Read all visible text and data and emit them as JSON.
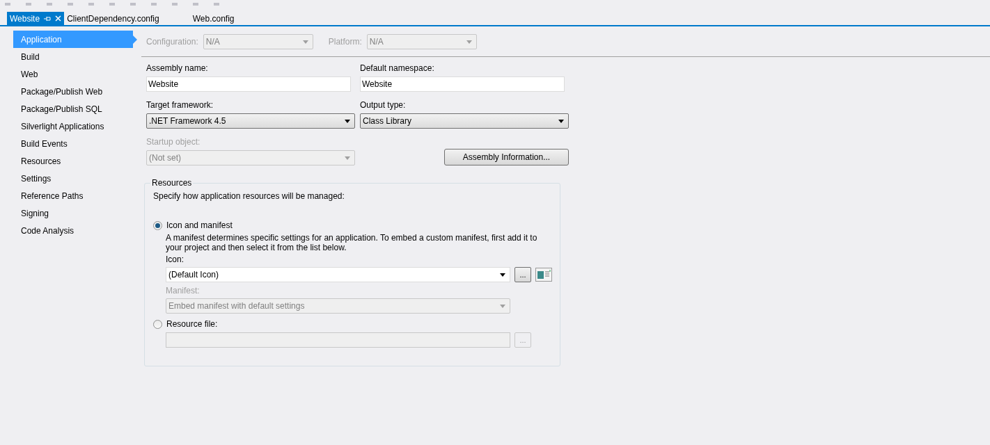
{
  "tabs": [
    {
      "label": "Website",
      "selected": true
    },
    {
      "label": "ClientDependency.config",
      "selected": false
    },
    {
      "label": "Web.config",
      "selected": false
    }
  ],
  "sidebar": {
    "items": [
      {
        "label": "Application",
        "selected": true
      },
      {
        "label": "Build",
        "selected": false
      },
      {
        "label": "Web",
        "selected": false
      },
      {
        "label": "Package/Publish Web",
        "selected": false
      },
      {
        "label": "Package/Publish SQL",
        "selected": false
      },
      {
        "label": "Silverlight Applications",
        "selected": false
      },
      {
        "label": "Build Events",
        "selected": false
      },
      {
        "label": "Resources",
        "selected": false
      },
      {
        "label": "Settings",
        "selected": false
      },
      {
        "label": "Reference Paths",
        "selected": false
      },
      {
        "label": "Signing",
        "selected": false
      },
      {
        "label": "Code Analysis",
        "selected": false
      }
    ]
  },
  "config_bar": [
    {
      "label": "Configuration:",
      "value": "N/A",
      "disabled": true
    },
    {
      "label": "Platform:",
      "value": "N/A",
      "disabled": true
    }
  ],
  "fields": [
    {
      "kind": "text",
      "label": "Assembly name:",
      "value": "Website"
    },
    {
      "kind": "text",
      "label": "Default namespace:",
      "value": "Website"
    },
    {
      "kind": "select",
      "label": "Target framework:",
      "value": ".NET Framework 4.5",
      "disabled": false
    },
    {
      "kind": "select",
      "label": "Output type:",
      "value": "Class Library",
      "disabled": false
    },
    {
      "kind": "select",
      "label": "Startup object:",
      "value": "(Not set)",
      "disabled": true
    },
    {
      "kind": "button",
      "label": "Assembly Information..."
    }
  ],
  "resources": {
    "title": "Resources",
    "description": "Specify how application resources will be managed:",
    "options": [
      {
        "label": "Icon and manifest",
        "selected": true
      },
      {
        "label": "Resource file:",
        "selected": false
      }
    ],
    "note": "A manifest determines specific settings for an application. To embed a custom manifest, first add it to your project and then select it from the list below.",
    "icon": {
      "label": "Icon:",
      "value": "(Default Icon)",
      "disabled": false,
      "browse": "..."
    },
    "manifest": {
      "label": "Manifest:",
      "value": "Embed manifest with default settings",
      "disabled": true
    },
    "resource_file": {
      "disabled": true,
      "browse": "..."
    }
  }
}
